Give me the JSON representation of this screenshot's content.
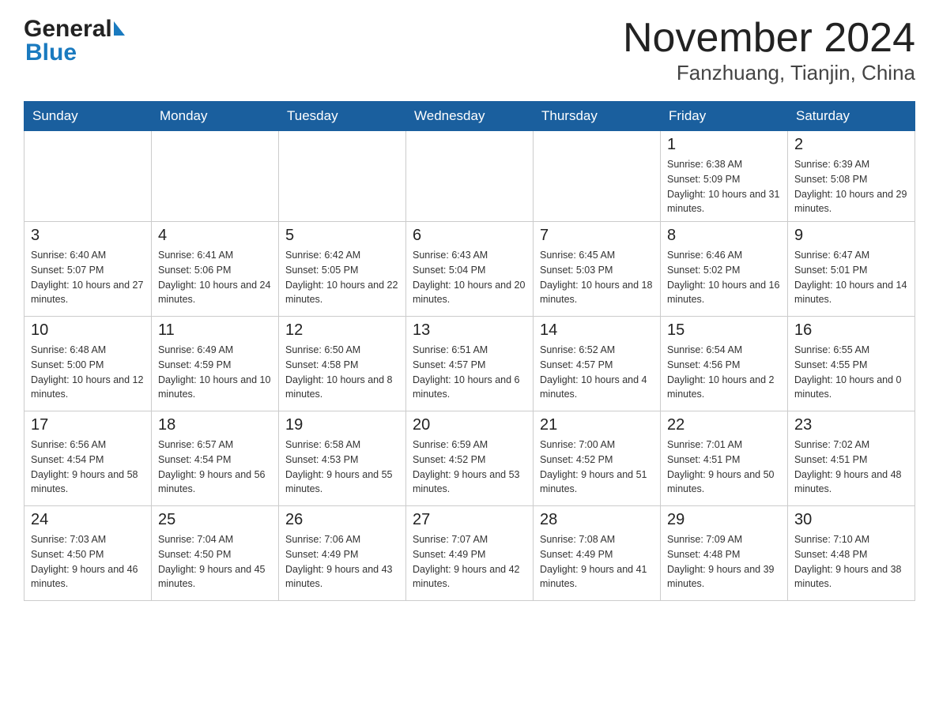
{
  "header": {
    "logo_general": "General",
    "logo_blue": "Blue",
    "title": "November 2024",
    "subtitle": "Fanzhuang, Tianjin, China"
  },
  "days_of_week": [
    "Sunday",
    "Monday",
    "Tuesday",
    "Wednesday",
    "Thursday",
    "Friday",
    "Saturday"
  ],
  "weeks": [
    [
      {
        "day": "",
        "info": ""
      },
      {
        "day": "",
        "info": ""
      },
      {
        "day": "",
        "info": ""
      },
      {
        "day": "",
        "info": ""
      },
      {
        "day": "",
        "info": ""
      },
      {
        "day": "1",
        "info": "Sunrise: 6:38 AM\nSunset: 5:09 PM\nDaylight: 10 hours and 31 minutes."
      },
      {
        "day": "2",
        "info": "Sunrise: 6:39 AM\nSunset: 5:08 PM\nDaylight: 10 hours and 29 minutes."
      }
    ],
    [
      {
        "day": "3",
        "info": "Sunrise: 6:40 AM\nSunset: 5:07 PM\nDaylight: 10 hours and 27 minutes."
      },
      {
        "day": "4",
        "info": "Sunrise: 6:41 AM\nSunset: 5:06 PM\nDaylight: 10 hours and 24 minutes."
      },
      {
        "day": "5",
        "info": "Sunrise: 6:42 AM\nSunset: 5:05 PM\nDaylight: 10 hours and 22 minutes."
      },
      {
        "day": "6",
        "info": "Sunrise: 6:43 AM\nSunset: 5:04 PM\nDaylight: 10 hours and 20 minutes."
      },
      {
        "day": "7",
        "info": "Sunrise: 6:45 AM\nSunset: 5:03 PM\nDaylight: 10 hours and 18 minutes."
      },
      {
        "day": "8",
        "info": "Sunrise: 6:46 AM\nSunset: 5:02 PM\nDaylight: 10 hours and 16 minutes."
      },
      {
        "day": "9",
        "info": "Sunrise: 6:47 AM\nSunset: 5:01 PM\nDaylight: 10 hours and 14 minutes."
      }
    ],
    [
      {
        "day": "10",
        "info": "Sunrise: 6:48 AM\nSunset: 5:00 PM\nDaylight: 10 hours and 12 minutes."
      },
      {
        "day": "11",
        "info": "Sunrise: 6:49 AM\nSunset: 4:59 PM\nDaylight: 10 hours and 10 minutes."
      },
      {
        "day": "12",
        "info": "Sunrise: 6:50 AM\nSunset: 4:58 PM\nDaylight: 10 hours and 8 minutes."
      },
      {
        "day": "13",
        "info": "Sunrise: 6:51 AM\nSunset: 4:57 PM\nDaylight: 10 hours and 6 minutes."
      },
      {
        "day": "14",
        "info": "Sunrise: 6:52 AM\nSunset: 4:57 PM\nDaylight: 10 hours and 4 minutes."
      },
      {
        "day": "15",
        "info": "Sunrise: 6:54 AM\nSunset: 4:56 PM\nDaylight: 10 hours and 2 minutes."
      },
      {
        "day": "16",
        "info": "Sunrise: 6:55 AM\nSunset: 4:55 PM\nDaylight: 10 hours and 0 minutes."
      }
    ],
    [
      {
        "day": "17",
        "info": "Sunrise: 6:56 AM\nSunset: 4:54 PM\nDaylight: 9 hours and 58 minutes."
      },
      {
        "day": "18",
        "info": "Sunrise: 6:57 AM\nSunset: 4:54 PM\nDaylight: 9 hours and 56 minutes."
      },
      {
        "day": "19",
        "info": "Sunrise: 6:58 AM\nSunset: 4:53 PM\nDaylight: 9 hours and 55 minutes."
      },
      {
        "day": "20",
        "info": "Sunrise: 6:59 AM\nSunset: 4:52 PM\nDaylight: 9 hours and 53 minutes."
      },
      {
        "day": "21",
        "info": "Sunrise: 7:00 AM\nSunset: 4:52 PM\nDaylight: 9 hours and 51 minutes."
      },
      {
        "day": "22",
        "info": "Sunrise: 7:01 AM\nSunset: 4:51 PM\nDaylight: 9 hours and 50 minutes."
      },
      {
        "day": "23",
        "info": "Sunrise: 7:02 AM\nSunset: 4:51 PM\nDaylight: 9 hours and 48 minutes."
      }
    ],
    [
      {
        "day": "24",
        "info": "Sunrise: 7:03 AM\nSunset: 4:50 PM\nDaylight: 9 hours and 46 minutes."
      },
      {
        "day": "25",
        "info": "Sunrise: 7:04 AM\nSunset: 4:50 PM\nDaylight: 9 hours and 45 minutes."
      },
      {
        "day": "26",
        "info": "Sunrise: 7:06 AM\nSunset: 4:49 PM\nDaylight: 9 hours and 43 minutes."
      },
      {
        "day": "27",
        "info": "Sunrise: 7:07 AM\nSunset: 4:49 PM\nDaylight: 9 hours and 42 minutes."
      },
      {
        "day": "28",
        "info": "Sunrise: 7:08 AM\nSunset: 4:49 PM\nDaylight: 9 hours and 41 minutes."
      },
      {
        "day": "29",
        "info": "Sunrise: 7:09 AM\nSunset: 4:48 PM\nDaylight: 9 hours and 39 minutes."
      },
      {
        "day": "30",
        "info": "Sunrise: 7:10 AM\nSunset: 4:48 PM\nDaylight: 9 hours and 38 minutes."
      }
    ]
  ]
}
